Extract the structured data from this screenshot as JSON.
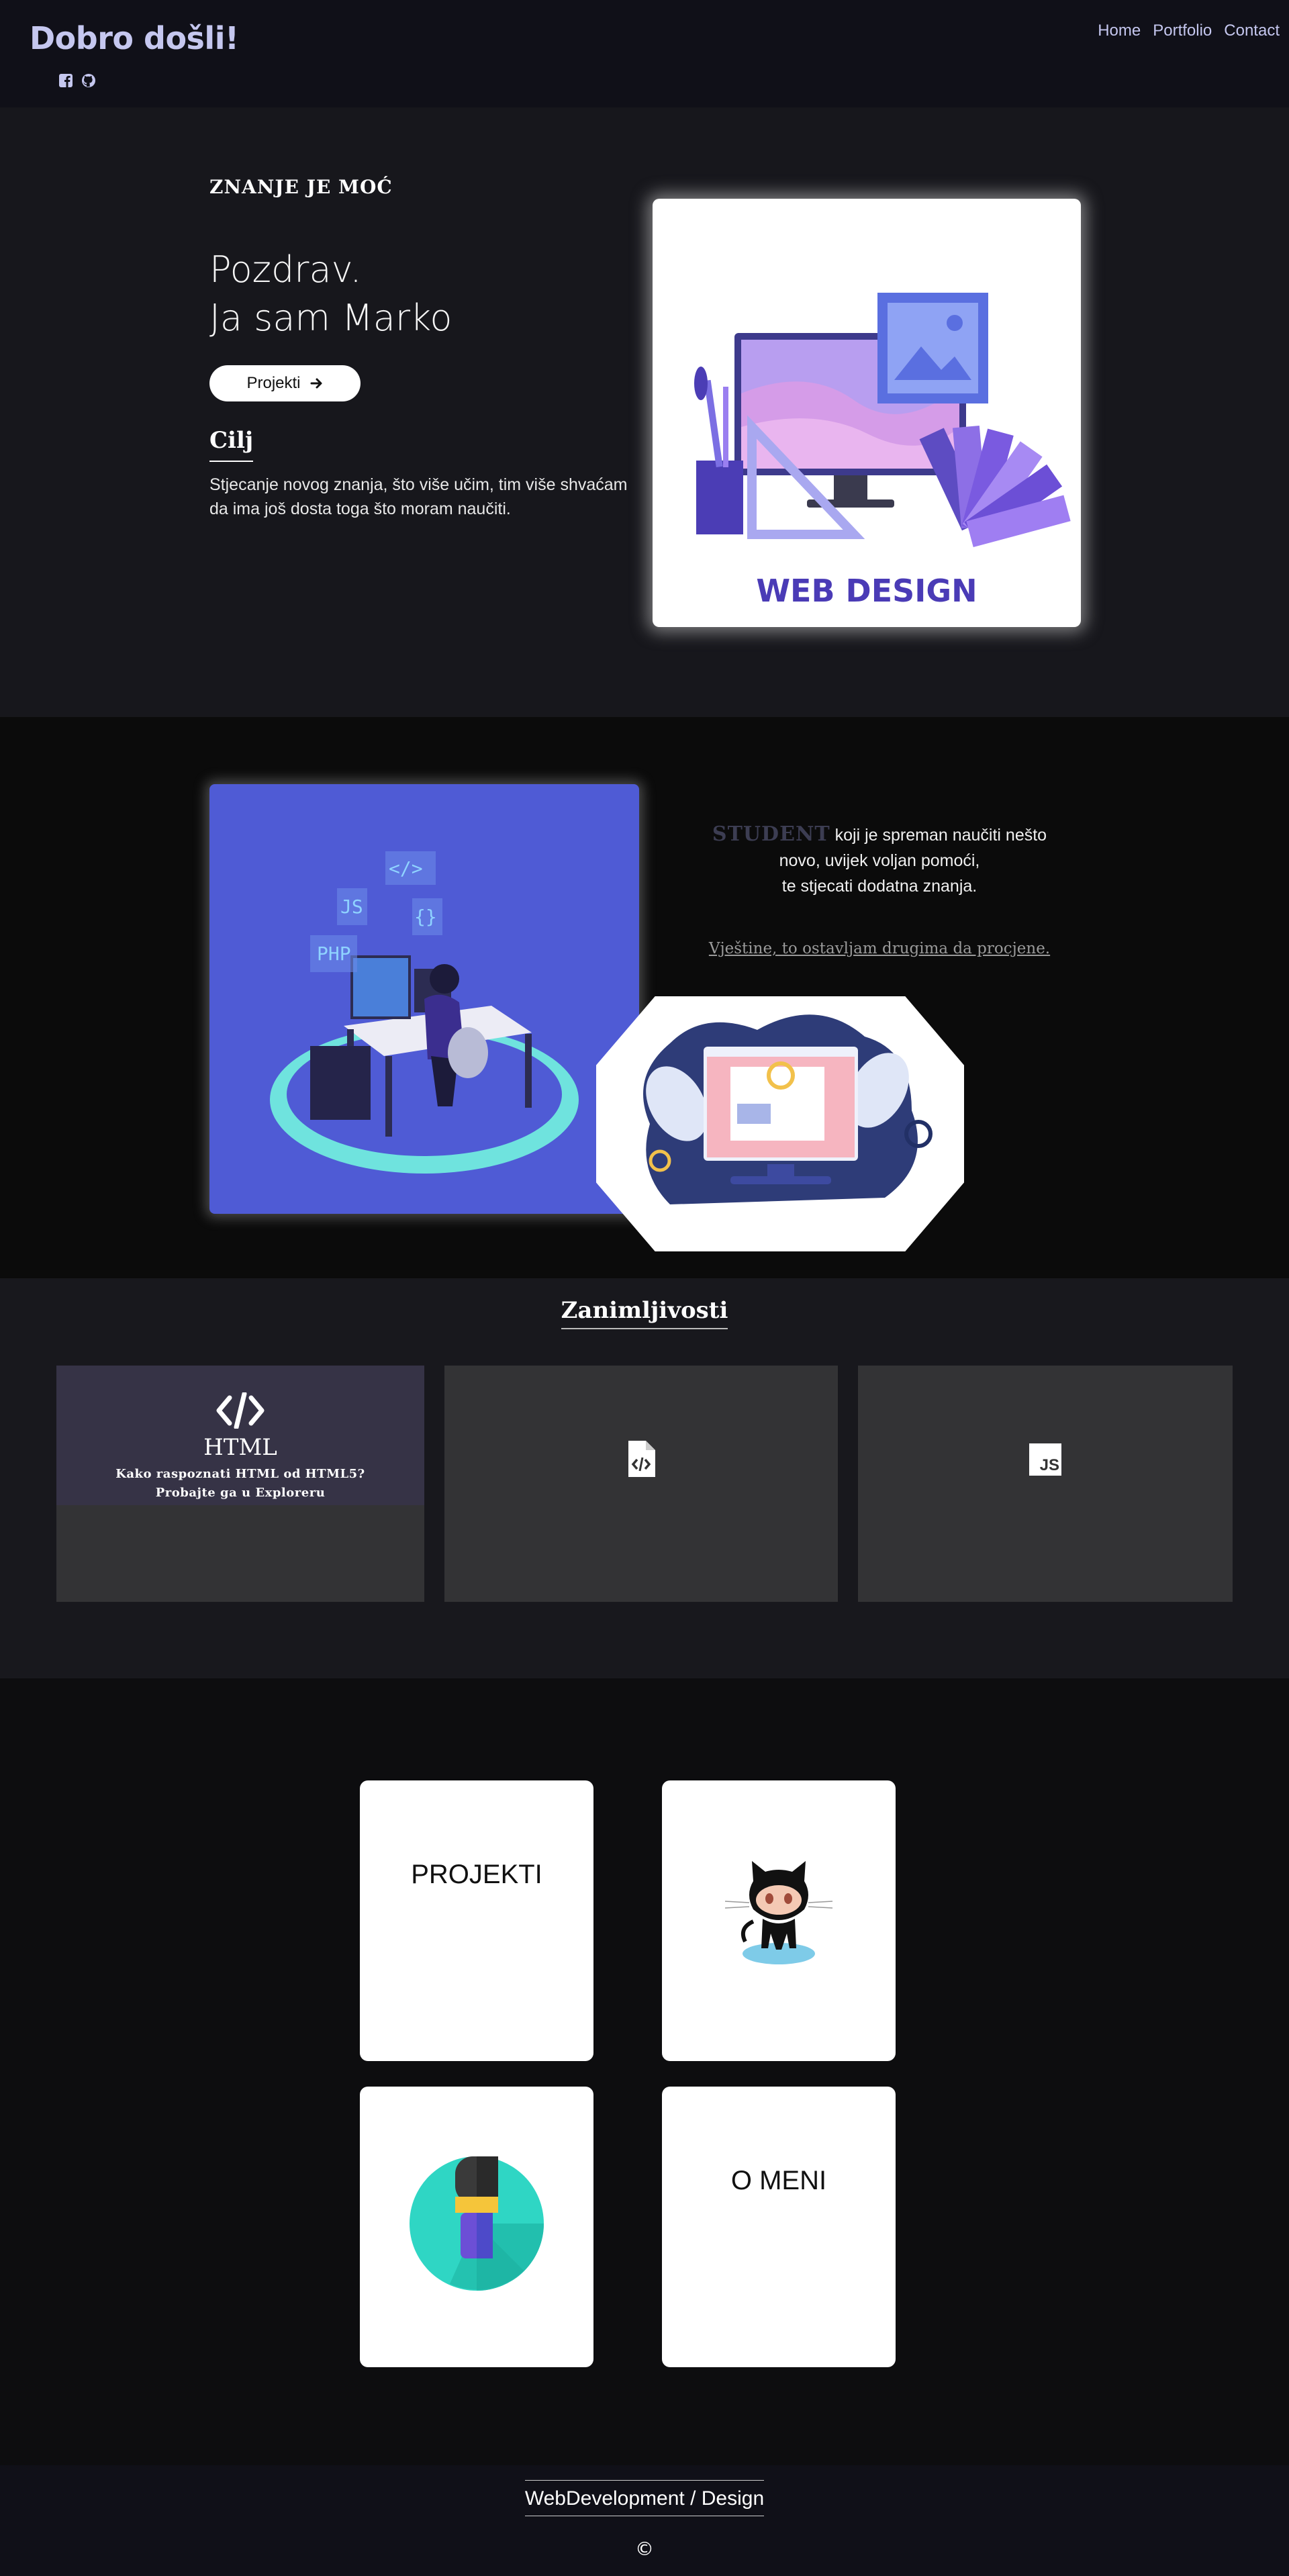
{
  "navbar": {
    "brand": "Dobro došli!",
    "links": [
      "Home",
      "Portfolio",
      "Contact"
    ],
    "socials": [
      "facebook-square-icon",
      "github-icon"
    ],
    "brand_color": "#c5c7ef"
  },
  "hero": {
    "eyebrow": "ZNANJE JE MOĆ",
    "greeting_line1": "Pozdrav.",
    "greeting_line2": "Ja sam Marko",
    "button_label": "Projekti",
    "goal_title": "Cilj",
    "goal_text": "Stjecanje novog znanja, što više učim, tim više shvaćam da ima još dosta toga što moram naučiti.",
    "image_caption": "WEB DESIGN"
  },
  "about": {
    "student": "STUDENT",
    "line1": "koji je spreman naučiti nešto",
    "line2": "novo, uvijek voljan pomoći,",
    "line3": "te stjecati dodatna znanja.",
    "link_text": "Vještine, to ostavljam drugima da procjene.",
    "dev_tags": [
      "JS",
      "</>",
      "{}",
      "PHP"
    ]
  },
  "fun": {
    "title": "Zanimljivosti",
    "cards": [
      {
        "icon": "code-icon",
        "title": "HTML",
        "sub1": "Kako raspoznati HTML od HTML5?",
        "sub2": "Probajte ga u Exploreru"
      },
      {
        "icon": "file-code-icon"
      },
      {
        "icon": "js-icon",
        "badge": "JS"
      }
    ]
  },
  "tiles": {
    "projekti": "PROJEKTI",
    "o_meni": "O MENI",
    "github_icon": "github-octocat-icon",
    "mic_icon": "microphone-icon"
  },
  "footer": {
    "link": "WebDevelopment / Design",
    "copyright": "©"
  }
}
